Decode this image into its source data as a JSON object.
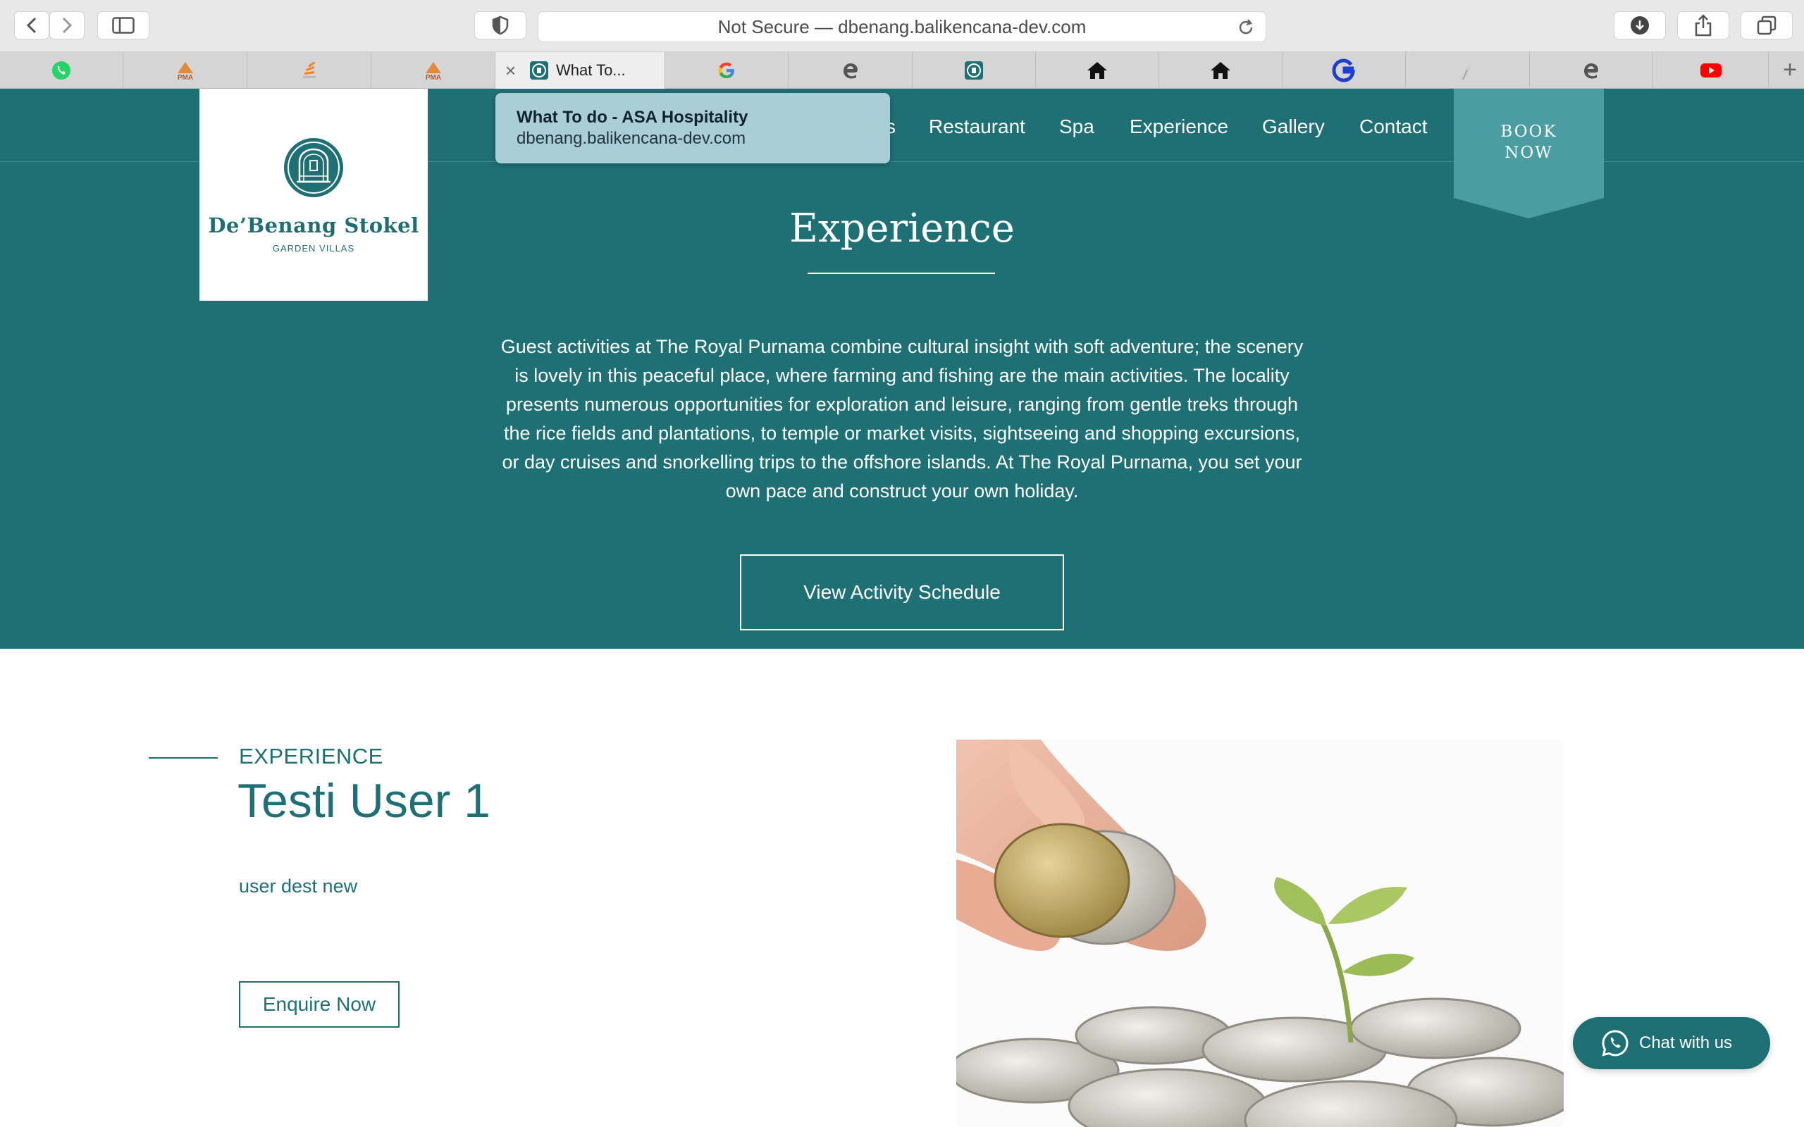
{
  "browser": {
    "address": "Not Secure — dbenang.balikencana-dev.com",
    "active_tab_title": "What To...",
    "tabs": [
      {
        "icon": "whatsapp-icon",
        "color": "#25D366"
      },
      {
        "icon": "pma-icon",
        "color": "#e08a3a",
        "text": "PMA"
      },
      {
        "icon": "stack-icon",
        "color": "#f48024"
      },
      {
        "icon": "pma-icon",
        "color": "#e08a3a",
        "text": "PMA"
      },
      {
        "icon": "site-icon",
        "color": "#1e7075",
        "active": true
      },
      {
        "icon": "google-icon",
        "color": "#4285F4"
      },
      {
        "icon": "edge-icon",
        "color": "#555555"
      },
      {
        "icon": "site-icon",
        "color": "#1e7075"
      },
      {
        "icon": "home-icon",
        "color": "#111111"
      },
      {
        "icon": "home-icon",
        "color": "#111111"
      },
      {
        "icon": "grammarly-icon",
        "color": "#15C39A"
      },
      {
        "icon": "feather-icon",
        "color": "#bbbbbb"
      },
      {
        "icon": "edge-icon",
        "color": "#555555"
      },
      {
        "icon": "youtube-icon",
        "color": "#FF0000"
      }
    ]
  },
  "tooltip": {
    "title": "What To do - ASA Hospitality",
    "url": "dbenang.balikencana-dev.com"
  },
  "logo": {
    "name": "De’Benang Stokel",
    "sub": "GARDEN VILLAS"
  },
  "nav": {
    "partial": "s",
    "items": [
      "Restaurant",
      "Spa",
      "Experience",
      "Gallery",
      "Contact"
    ],
    "book_line1": "BOOK",
    "book_line2": "NOW"
  },
  "hero": {
    "title": "Experience",
    "text": "Guest activities at The Royal Purnama combine cultural insight with soft adventure; the scenery is lovely in this peaceful place, where farming and fishing are the main activities. The locality presents numerous opportunities for exploration and leisure, ranging from gentle treks through the rice fields and plantations, to temple or market visits, sightseeing and shopping excursions, or day cruises and snorkelling trips to the offshore islands. At The Royal Purnama, you set your own pace and construct your own holiday.",
    "button": "View Activity Schedule"
  },
  "experience": {
    "kicker": "EXPERIENCE",
    "title": "Testi User 1",
    "desc": "user dest new",
    "button": "Enquire Now"
  },
  "chat": {
    "label": "Chat with us"
  },
  "colors": {
    "brand": "#1e7075",
    "book_bg": "#4a9ea2",
    "tooltip_bg": "#a9ced3"
  }
}
